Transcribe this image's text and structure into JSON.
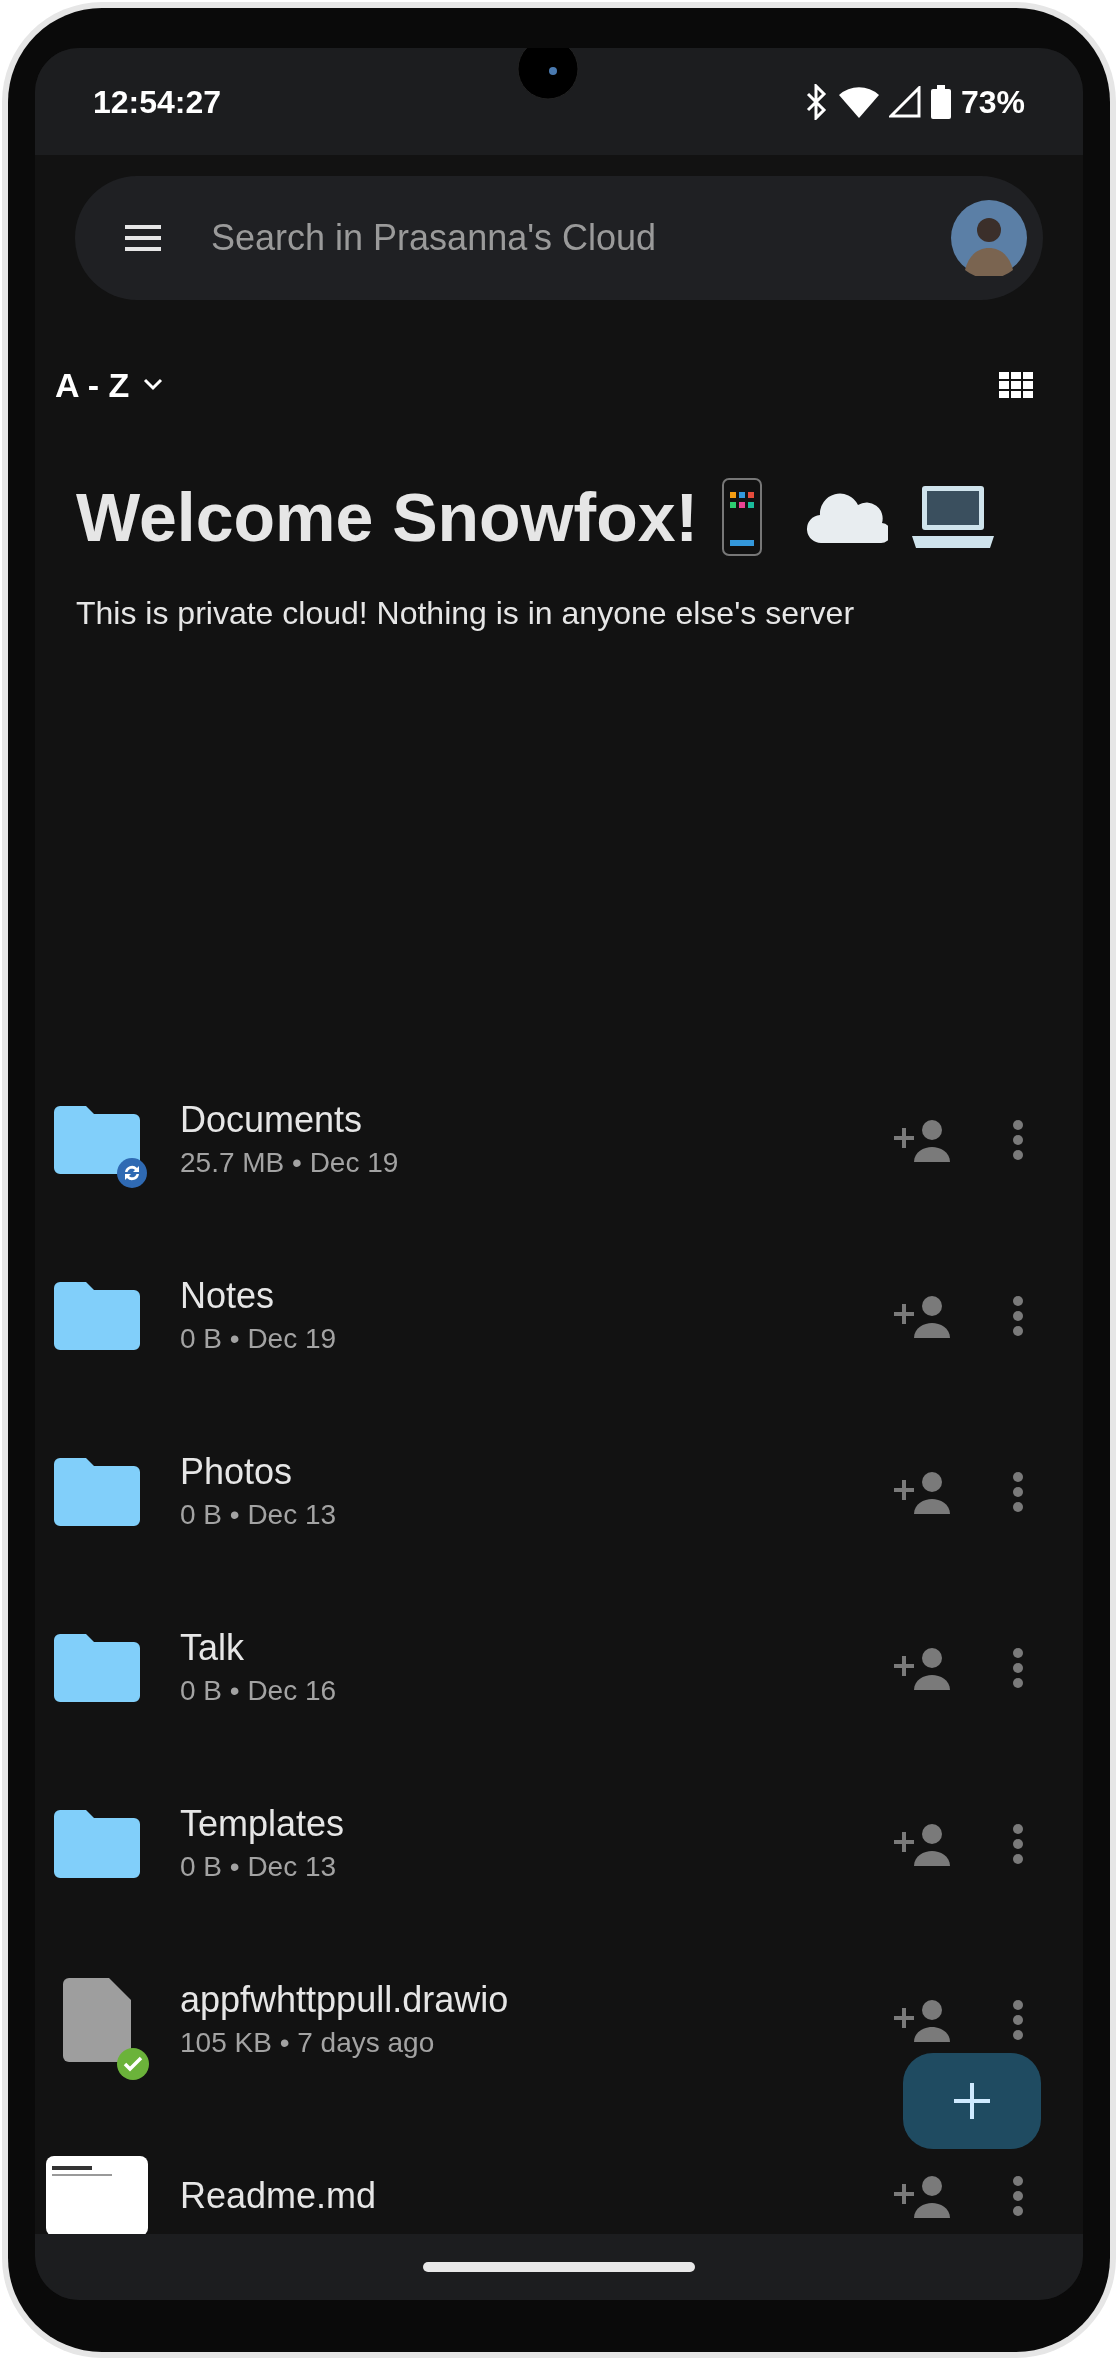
{
  "status_bar": {
    "time": "12:54:27",
    "battery": "73%"
  },
  "search": {
    "placeholder": "Search in Prasanna's Cloud"
  },
  "sort": {
    "label": "A - Z"
  },
  "welcome": {
    "title": "Welcome Snowfox!",
    "subtitle": "This is private cloud! Nothing is in anyone else's server"
  },
  "files": [
    {
      "kind": "folder",
      "name": "Documents",
      "details": "25.7 MB • Dec 19",
      "syncing": true,
      "synced": false
    },
    {
      "kind": "folder",
      "name": "Notes",
      "details": "0 B • Dec 19",
      "syncing": false,
      "synced": false
    },
    {
      "kind": "folder",
      "name": "Photos",
      "details": "0 B • Dec 13",
      "syncing": false,
      "synced": false
    },
    {
      "kind": "folder",
      "name": "Talk",
      "details": "0 B • Dec 16",
      "syncing": false,
      "synced": false
    },
    {
      "kind": "folder",
      "name": "Templates",
      "details": "0 B • Dec 13",
      "syncing": false,
      "synced": false
    },
    {
      "kind": "file",
      "name": "appfwhttppull.drawio",
      "details": "105 KB • 7 days ago",
      "syncing": false,
      "synced": true
    },
    {
      "kind": "thumbnail",
      "name": "Readme.md",
      "syncing": false,
      "synced": false
    }
  ]
}
